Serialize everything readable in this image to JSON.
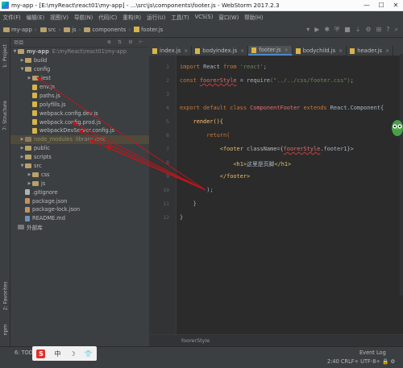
{
  "window": {
    "title": "my-app - [E:\\myReact\\react01\\my-app] - ...\\src\\js\\components\\footer.js - WebStorm 2017.2.3"
  },
  "menu": [
    "文件(F)",
    "编辑(E)",
    "视图(V)",
    "导航(N)",
    "代码(C)",
    "重构(R)",
    "运行(U)",
    "工具(T)",
    "VCS(S)",
    "窗口(W)",
    "帮助(H)"
  ],
  "breadcrumbs": [
    "my-app",
    "src",
    "js",
    "components",
    "footer.js"
  ],
  "left_strip": {
    "project": "1: Project",
    "structure": "7: Structure",
    "favorites": "2: Favorites",
    "npm": "npm"
  },
  "project_header": {
    "label": "项目",
    "tools": "⊕ ⇅ ⚙ ⊢"
  },
  "tree": [
    {
      "arrow": "▼",
      "icon": "folder",
      "name": "my-app",
      "path": "E:\\myReact\\react01\\my-app"
    },
    {
      "arrow": "▶",
      "icon": "folder",
      "name": "build"
    },
    {
      "arrow": "▼",
      "icon": "folder",
      "name": "config"
    },
    {
      "arrow": "▶",
      "icon": "folder",
      "name": "jest"
    },
    {
      "arrow": "",
      "icon": "js",
      "name": "env.js"
    },
    {
      "arrow": "",
      "icon": "js",
      "name": "paths.js"
    },
    {
      "arrow": "",
      "icon": "js",
      "name": "polyfills.js"
    },
    {
      "arrow": "",
      "icon": "js",
      "name": "webpack.config.dev.js"
    },
    {
      "arrow": "",
      "icon": "js",
      "name": "webpack.config.prod.js"
    },
    {
      "arrow": "",
      "icon": "js",
      "name": "webpackDevServer.config.js"
    },
    {
      "arrow": "▶",
      "icon": "folder-ex",
      "name": "node_modules",
      "path": "library root"
    },
    {
      "arrow": "▶",
      "icon": "folder",
      "name": "public"
    },
    {
      "arrow": "▶",
      "icon": "folder",
      "name": "scripts"
    },
    {
      "arrow": "▼",
      "icon": "folder",
      "name": "src"
    },
    {
      "arrow": "▶",
      "icon": "folder",
      "name": "css"
    },
    {
      "arrow": "▶",
      "icon": "folder",
      "name": "js"
    },
    {
      "arrow": "",
      "icon": "git",
      "name": ".gitignore"
    },
    {
      "arrow": "",
      "icon": "json",
      "name": "package.json"
    },
    {
      "arrow": "",
      "icon": "json",
      "name": "package-lock.json"
    },
    {
      "arrow": "",
      "icon": "md",
      "name": "README.md"
    },
    {
      "arrow": "",
      "icon": "lib",
      "name": "外部库"
    }
  ],
  "tabs": [
    {
      "label": "index.js",
      "active": false
    },
    {
      "label": "bodyindex.js",
      "active": false
    },
    {
      "label": "footer.js",
      "active": true
    },
    {
      "label": "bodychild.js",
      "active": false
    },
    {
      "label": "header.js",
      "active": false
    }
  ],
  "code_lines": [
    {
      "n": "1"
    },
    {
      "n": "2"
    },
    {
      "n": "3"
    },
    {
      "n": "4"
    },
    {
      "n": "5"
    },
    {
      "n": "6"
    },
    {
      "n": "7"
    },
    {
      "n": "8"
    },
    {
      "n": "9"
    },
    {
      "n": "10"
    },
    {
      "n": "11"
    },
    {
      "n": "12"
    }
  ],
  "code": {
    "l1_import": "import",
    "l1_react": "React",
    "l1_from": "from",
    "l1_str": "'react'",
    "l1_end": ";",
    "l2_const": "const",
    "l2_ident": "foorerStyle",
    "l2_eq": " = ",
    "l2_req": "require",
    "l2_str": "(\"../../css/footer.css\")",
    "l2_end": ";",
    "l4_export": "export default class",
    "l4_name": "ComponentFooter",
    "l4_extends": "extends",
    "l4_base": "React.Component{",
    "l5": "render(){",
    "l6": "return(",
    "l7_open": "<footer ",
    "l7_attr": "className",
    "l7_eq": "={",
    "l7_ident": "foorerStyle",
    "l7_rest": ".footer1}>",
    "l8_h1o": "<h1>",
    "l8_text": "这里是页脚",
    "l8_h1c": "</h1>",
    "l9": "</footer>",
    "l10": ");",
    "l11": "}",
    "l12": "}"
  },
  "editor_footer": "foorerStyle",
  "status": {
    "todo": "6: TODO",
    "event_log": "Event Log",
    "position": "2:40   CRLF÷   UTF-8÷   🔒   ⚙"
  },
  "ime": {
    "logo": "S",
    "lang": "中",
    "moon": "☽",
    "shirt": "👕"
  },
  "colors": {
    "arrow": "#c0151a",
    "accent": "#4a88c7",
    "selected": "#0d293e"
  }
}
